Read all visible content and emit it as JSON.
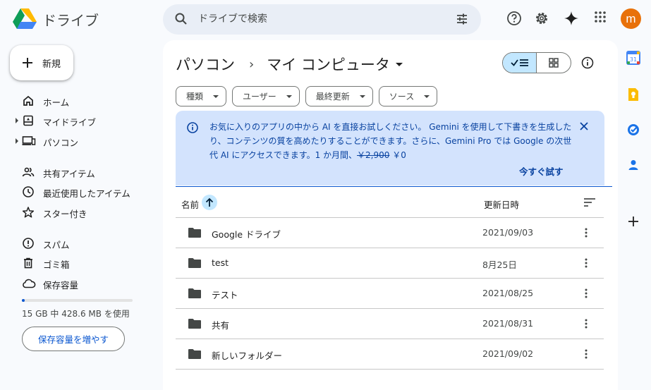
{
  "app": {
    "name": "ドライブ"
  },
  "search": {
    "placeholder": "ドライブで検索"
  },
  "account": {
    "initial": "m",
    "color": "#e8710a"
  },
  "sidebar": {
    "new_label": "新規",
    "items": [
      {
        "label": "ホーム",
        "icon": "home-icon"
      },
      {
        "label": "マイドライブ",
        "icon": "my-drive-icon",
        "expandable": true
      },
      {
        "label": "パソコン",
        "icon": "computers-icon",
        "expandable": true
      },
      {
        "label": "共有アイテム",
        "icon": "shared-icon"
      },
      {
        "label": "最近使用したアイテム",
        "icon": "clock-icon"
      },
      {
        "label": "スター付き",
        "icon": "star-icon"
      },
      {
        "label": "スパム",
        "icon": "spam-icon"
      },
      {
        "label": "ゴミ箱",
        "icon": "trash-icon"
      },
      {
        "label": "保存容量",
        "icon": "cloud-icon"
      }
    ],
    "storage": {
      "text": "15 GB 中 428.6 MB を使用",
      "used_fraction": 0.028
    },
    "more_storage_label": "保存容量を増やす"
  },
  "breadcrumb": {
    "root": "パソコン",
    "separator": "›",
    "current": "マイ コンピュータ"
  },
  "filters": [
    "種類",
    "ユーザー",
    "最終更新",
    "ソース"
  ],
  "banner": {
    "text_main": "お気に入りのアプリの中から AI を直接お試しください。 Gemini を使用して下書きを生成したり、コンテンツの質を高めたりすることができます。さらに、Gemini Pro では Google の次世代 AI にアクセスできます。1 か月間、",
    "old_price": "￥2,900",
    "new_price": " ￥0",
    "action": "今すぐ試す"
  },
  "table": {
    "col_name": "名前",
    "col_modified": "更新日時",
    "rows": [
      {
        "name": "Google ドライブ",
        "modified": "2021/09/03"
      },
      {
        "name": "test",
        "modified": "8月25日"
      },
      {
        "name": "テスト",
        "modified": "2021/08/25"
      },
      {
        "name": "共有",
        "modified": "2021/08/31"
      },
      {
        "name": "新しいフォルダー",
        "modified": "2021/09/02"
      }
    ]
  },
  "colors": {
    "accent": "#0b57d0",
    "selected": "#c2e7ff",
    "banner": "#d3e3fd"
  }
}
